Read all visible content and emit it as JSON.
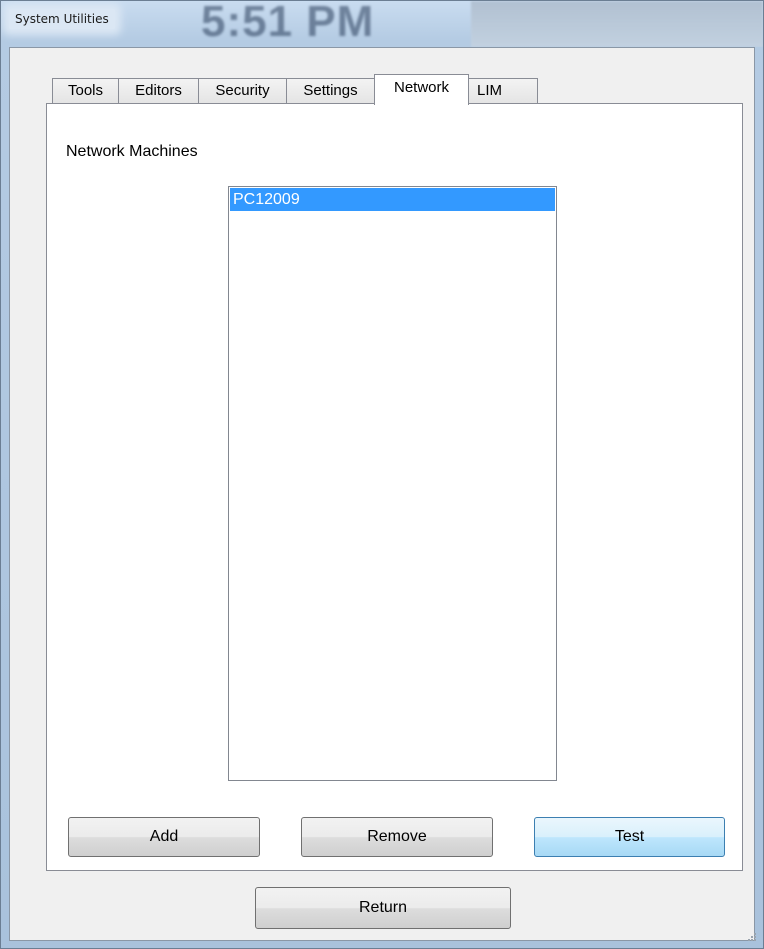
{
  "window": {
    "title": "System Utilities",
    "background_clock": "5:51 PM"
  },
  "tabs": [
    {
      "label": "Tools",
      "active": false
    },
    {
      "label": "Editors",
      "active": false
    },
    {
      "label": "Security",
      "active": false
    },
    {
      "label": "Settings",
      "active": false
    },
    {
      "label": "Network",
      "active": true
    },
    {
      "label": "LIM",
      "active": false
    }
  ],
  "network": {
    "section_label": "Network Machines",
    "machines": [
      {
        "name": "PC12009",
        "selected": true
      }
    ]
  },
  "buttons": {
    "add": "Add",
    "remove": "Remove",
    "test": "Test",
    "return": "Return"
  },
  "colors": {
    "selection": "#3399ff",
    "default_button_border": "#3c7fb1"
  }
}
